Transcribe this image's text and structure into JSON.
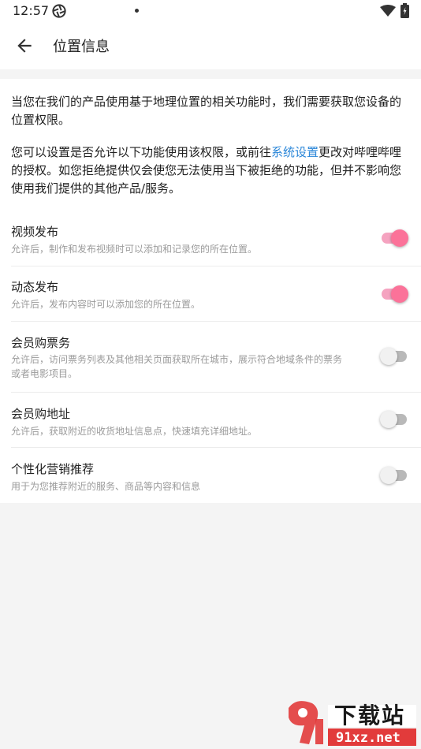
{
  "status_bar": {
    "time": "12:57"
  },
  "header": {
    "title": "位置信息"
  },
  "intro": {
    "p1": "当您在我们的产品使用基于地理位置的相关功能时，我们需要获取您设备的位置权限。",
    "p2_before": "您可以设置是否允许以下功能使用该权限，或前往",
    "p2_link": "系统设置",
    "p2_after": "更改对哔哩哔哩的授权。如您拒绝提供仅会使您无法使用当下被拒绝的功能，但并不影响您使用我们提供的其他产品/服务。"
  },
  "settings": [
    {
      "label": "视频发布",
      "desc": "允许后，制作和发布视频时可以添加和记录您的所在位置。",
      "enabled": true
    },
    {
      "label": "动态发布",
      "desc": "允许后，发布内容时可以添加您的所在位置。",
      "enabled": true
    },
    {
      "label": "会员购票务",
      "desc": "允许后，访问票务列表及其他相关页面获取所在城市，展示符合地域条件的票务或者电影项目。",
      "enabled": false
    },
    {
      "label": "会员购地址",
      "desc": "允许后，获取附近的收货地址信息点，快速填充详细地址。",
      "enabled": false
    },
    {
      "label": "个性化营销推荐",
      "desc": "用于为您推荐附近的服务、商品等内容和信息",
      "enabled": false
    }
  ],
  "watermark": {
    "brand": "下载站",
    "domain": "91xz.net"
  },
  "colors": {
    "accent": "#fb7299",
    "link": "#2a86d8"
  },
  "icons": {
    "back": "arrow-left-icon",
    "app": "aperture-icon",
    "wifi": "wifi-icon",
    "battery": "battery-icon"
  }
}
